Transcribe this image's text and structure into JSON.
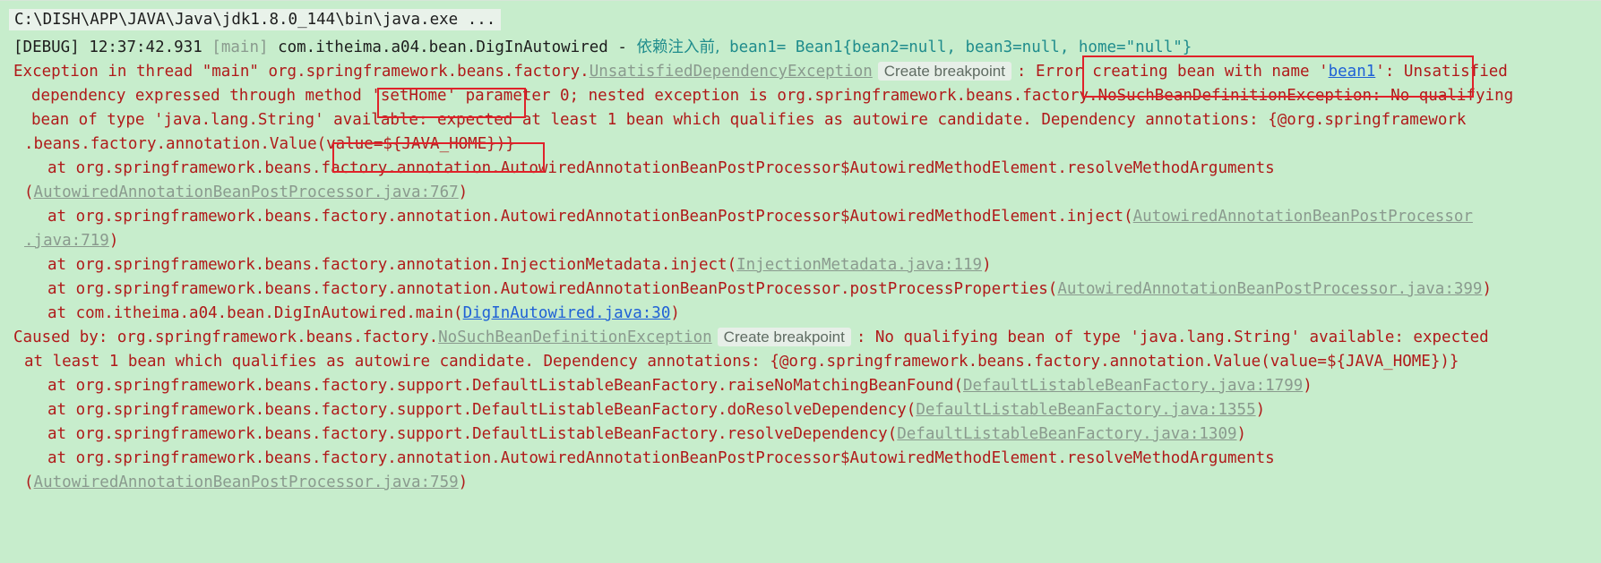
{
  "console": {
    "command": "C:\\DISH\\APP\\JAVA\\Java\\jdk1.8.0_144\\bin\\java.exe ...",
    "debug": {
      "level": "[DEBUG]",
      "time": "12:37:42.931",
      "thread": "[main]",
      "logger": "com.itheima.a04.bean.DigInAutowired",
      "dash": "-",
      "message_cn": "依赖注入前,",
      "message_rest": " bean1= Bean1{bean2=null, bean3=null, home=\"null\"}"
    },
    "exception": {
      "prefix": "Exception in thread \"main\" org.springframework.beans.factory.",
      "class_link": "UnsatisfiedDependencyException",
      "breakpoint_label": "Create breakpoint",
      "msg_a": ": Error creating bean with name '",
      "bean_link": "bean1",
      "msg_b": "': Unsatisfied",
      "line2": "dependency expressed through method 'setHome' parameter 0; nested exception is org.springframework.beans.factory.NoSuchBeanDefinitionException: No qualifying",
      "line3": "bean of type 'java.lang.String' available: expected at least 1 bean which qualifies as autowire candidate. Dependency annotations: {@org.springframework",
      "line4": ".beans.factory.annotation.Value(value=${JAVA_HOME})}"
    },
    "stack1": [
      {
        "at": "at org.springframework.beans.factory.annotation.AutowiredAnnotationBeanPostProcessor$AutowiredMethodElement.resolveMethodArguments",
        "open": "(",
        "src": "AutowiredAnnotationBeanPostProcessor.java:767",
        "close": ")"
      },
      {
        "at": "at org.springframework.beans.factory.annotation.AutowiredAnnotationBeanPostProcessor$AutowiredMethodElement.inject(",
        "src1": "AutowiredAnnotationBeanPostProcessor",
        "src2": ".java:719",
        "close": ")"
      },
      {
        "at": "at org.springframework.beans.factory.annotation.InjectionMetadata.inject(",
        "src": "InjectionMetadata.java:119",
        "close": ")"
      },
      {
        "at": "at org.springframework.beans.factory.annotation.AutowiredAnnotationBeanPostProcessor.postProcessProperties(",
        "src": "AutowiredAnnotationBeanPostProcessor.java:399",
        "close": ")"
      },
      {
        "at": "at com.itheima.a04.bean.DigInAutowired.main(",
        "src": "DigInAutowired.java:30",
        "close": ")"
      }
    ],
    "caused": {
      "prefix": "Caused by: org.springframework.beans.factory.",
      "class_link": "NoSuchBeanDefinitionException",
      "breakpoint_label": "Create breakpoint",
      "msg": ": No qualifying bean of type 'java.lang.String' available: expected",
      "line2": "at least 1 bean which qualifies as autowire candidate. Dependency annotations: {@org.springframework.beans.factory.annotation.Value(value=${JAVA_HOME})}"
    },
    "stack2": [
      {
        "at": "at org.springframework.beans.factory.support.DefaultListableBeanFactory.raiseNoMatchingBeanFound(",
        "src": "DefaultListableBeanFactory.java:1799",
        "close": ")"
      },
      {
        "at": "at org.springframework.beans.factory.support.DefaultListableBeanFactory.doResolveDependency(",
        "src": "DefaultListableBeanFactory.java:1355",
        "close": ")"
      },
      {
        "at": "at org.springframework.beans.factory.support.DefaultListableBeanFactory.resolveDependency(",
        "src": "DefaultListableBeanFactory.java:1309",
        "close": ")"
      },
      {
        "at": "at org.springframework.beans.factory.annotation.AutowiredAnnotationBeanPostProcessor$AutowiredMethodElement.resolveMethodArguments",
        "open": "(",
        "src": "AutowiredAnnotationBeanPostProcessor.java:759",
        "close": ")"
      }
    ]
  },
  "colors": {
    "background": "#c7edcc",
    "error_text": "#b01a1a",
    "link": "#1f61d6",
    "muted": "#8a9a8e",
    "chinese_text": "#1f8c8c",
    "highlight_box": "#e0222a"
  }
}
